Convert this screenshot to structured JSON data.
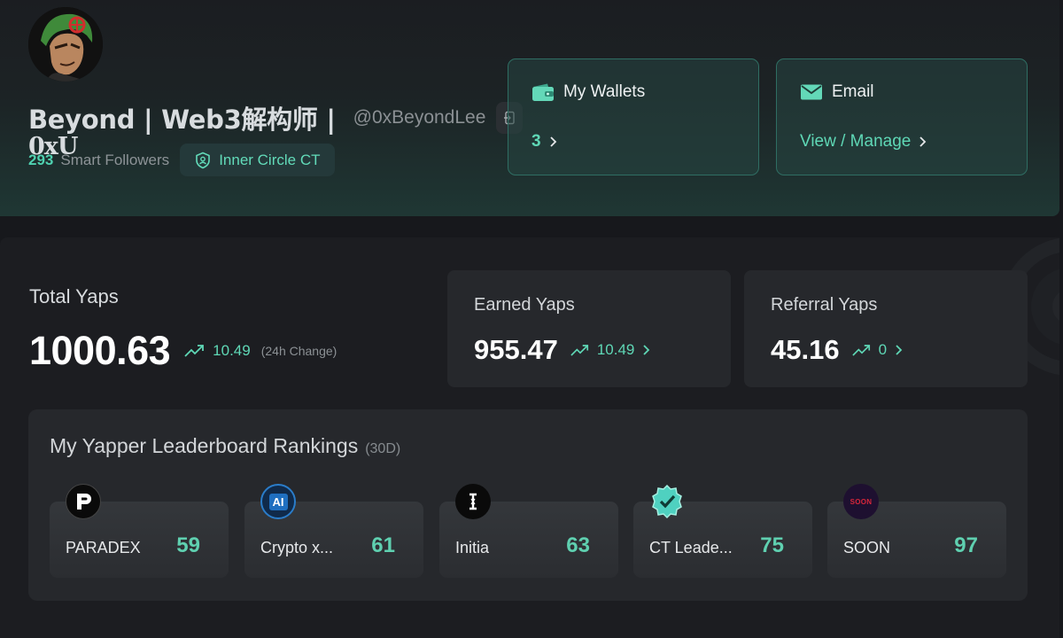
{
  "profile": {
    "display_name": "Beyond | Web3解构师 |",
    "display_name_overflow": "0xU",
    "handle": "@0xBeyondLee",
    "smart_followers_count": "293",
    "smart_followers_label": "Smart Followers",
    "badge_label": "Inner Circle CT"
  },
  "wallets": {
    "title": "My Wallets",
    "value": "3"
  },
  "email": {
    "title": "Email",
    "action": "View / Manage"
  },
  "total_yaps": {
    "title": "Total Yaps",
    "value": "1000.63",
    "change": "10.49",
    "change_note": "(24h Change)"
  },
  "earned_yaps": {
    "title": "Earned Yaps",
    "value": "955.47",
    "change": "10.49"
  },
  "referral_yaps": {
    "title": "Referral Yaps",
    "value": "45.16",
    "change": "0"
  },
  "leaderboard": {
    "title": "My Yapper Leaderboard Rankings",
    "period": "(30D)",
    "rankings": [
      {
        "name": "PARADEX",
        "rank": "59",
        "icon": "paradex-logo-icon"
      },
      {
        "name": "Crypto x...",
        "rank": "61",
        "icon": "crypto-ai-logo-icon",
        "logo_text": "AI"
      },
      {
        "name": "Initia",
        "rank": "63",
        "icon": "initia-logo-icon"
      },
      {
        "name": "CT Leade...",
        "rank": "75",
        "icon": "ct-leaderboard-logo-icon"
      },
      {
        "name": "SOON",
        "rank": "97",
        "icon": "soon-logo-icon",
        "logo_text": "SOON"
      }
    ]
  },
  "colors": {
    "accent": "#5fd8b6",
    "background": "#17181c",
    "card": "#26282c",
    "card_border": "#2f6e63"
  }
}
